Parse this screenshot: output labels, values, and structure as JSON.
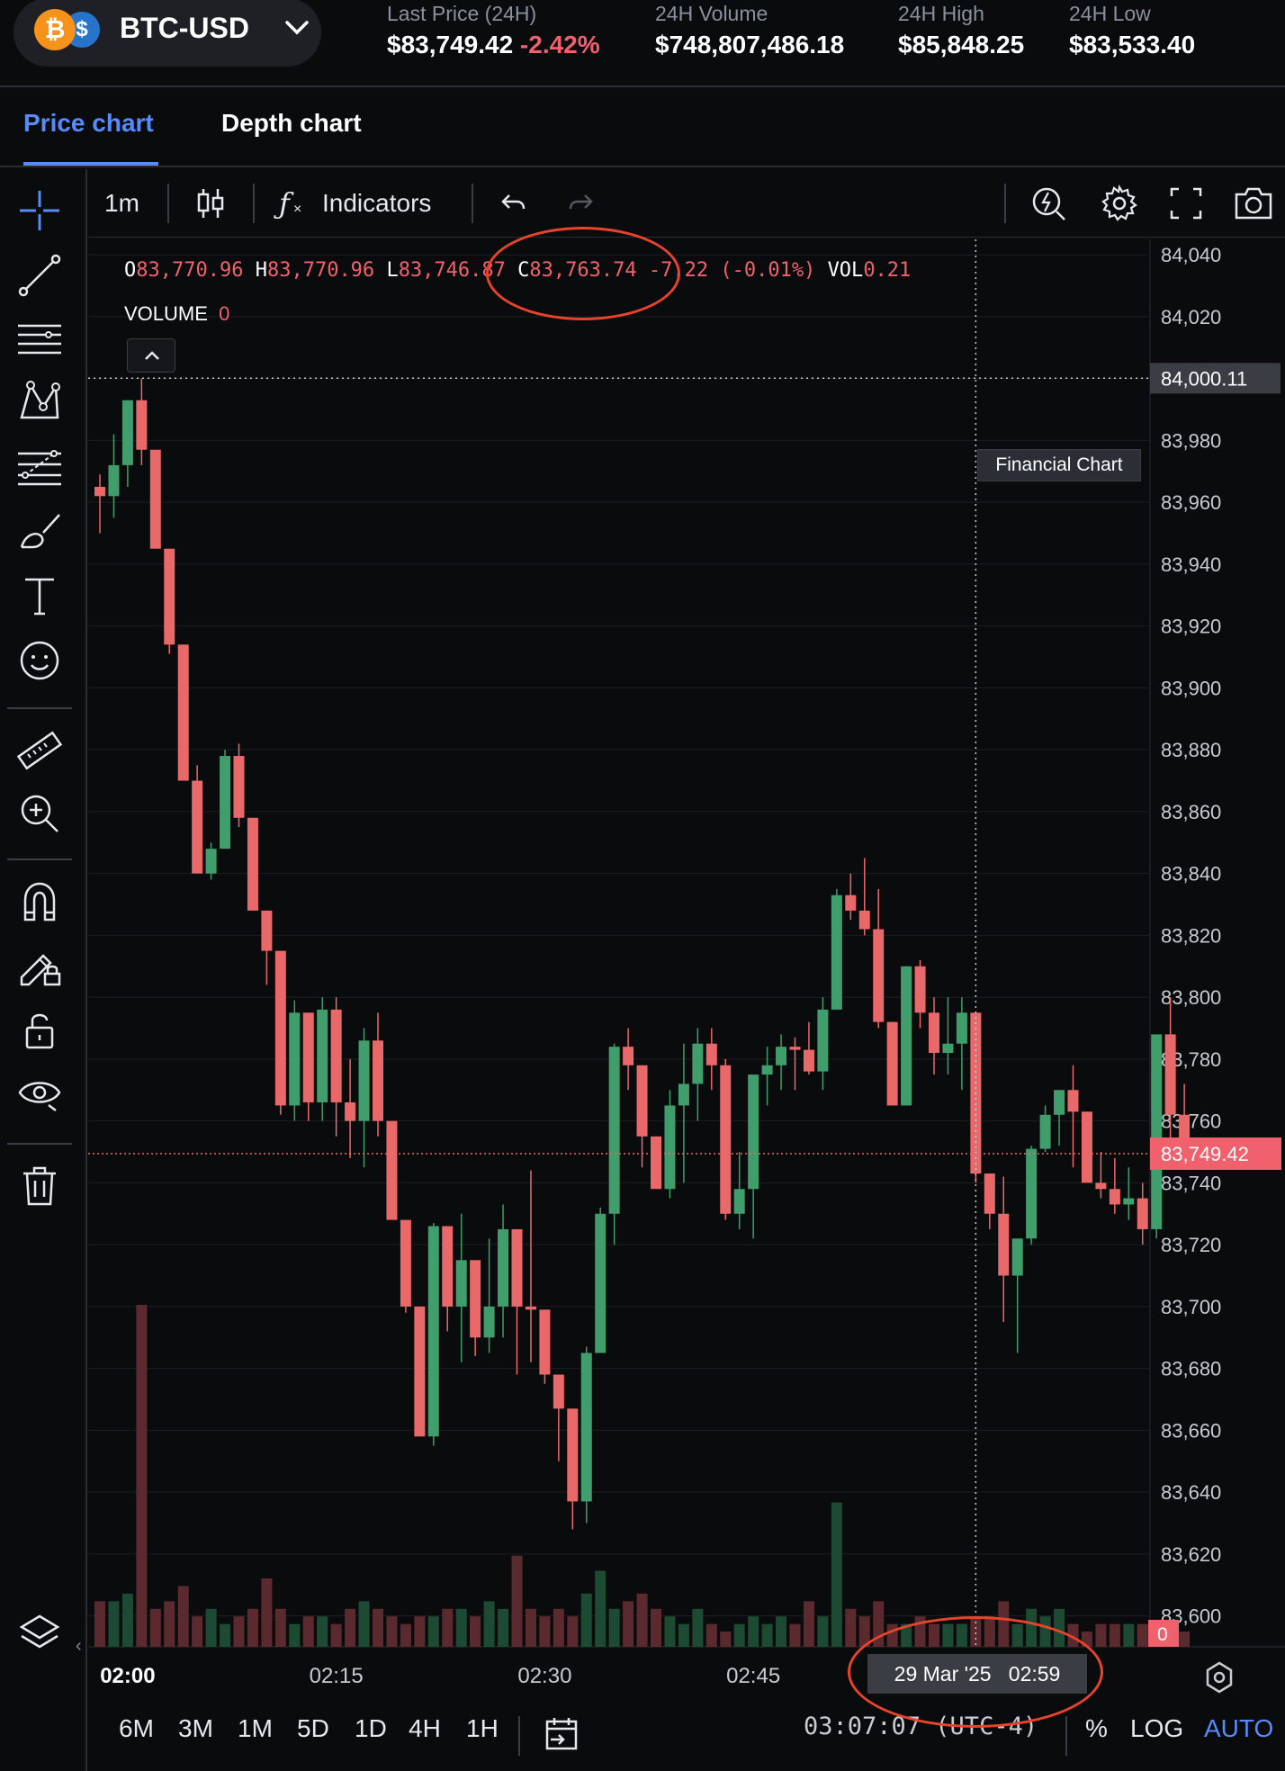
{
  "header": {
    "pair": "BTC-USD",
    "coin_btc": "₿",
    "coin_usd": "$",
    "stats": [
      {
        "label": "Last Price (24H)",
        "value": "$83,749.42",
        "change": "-2.42%"
      },
      {
        "label": "24H Volume",
        "value": "$748,807,486.18"
      },
      {
        "label": "24H High",
        "value": "$85,848.25"
      },
      {
        "label": "24H Low",
        "value": "$83,533.40"
      }
    ]
  },
  "tabs": [
    {
      "label": "Price chart",
      "active": true
    },
    {
      "label": "Depth chart",
      "active": false
    }
  ],
  "toolbar": {
    "interval": "1m",
    "fx": "ƒ",
    "indicators_label": "Indicators"
  },
  "sidebar_tools": [
    "crosshair-icon",
    "trend-line-icon",
    "horizontal-lines-icon",
    "pattern-icon",
    "fib-levels-icon",
    "brush-icon",
    "text-tool-icon",
    "emoji-icon",
    "ruler-icon",
    "zoom-in-icon",
    "magnet-icon",
    "lock-drawing-icon",
    "unlock-icon",
    "eye-icon",
    "trash-icon",
    "layers-icon"
  ],
  "legend": {
    "o_label": "O",
    "o": "83,770.96",
    "h_label": "H",
    "h": "83,770.96",
    "l_label": "L",
    "l": "83,746.87",
    "c_label": "C",
    "c": "83,763.74",
    "change": "-7.22 (-0.01%)",
    "vol_label": "VOL",
    "vol": "0.21",
    "volume_label": "VOLUME",
    "volume": "0"
  },
  "tooltip": "Financial Chart",
  "bottom": {
    "ranges": [
      "6M",
      "3M",
      "1M",
      "5D",
      "1D",
      "4H",
      "1H"
    ],
    "clock": "03:07:07 (UTC-4)",
    "options": [
      {
        "label": "%",
        "active": false
      },
      {
        "label": "LOG",
        "active": false
      },
      {
        "label": "AUTO",
        "active": true
      }
    ]
  },
  "chart_data": {
    "type": "candlestick",
    "interval": "1m",
    "ylim": [
      83590,
      84045
    ],
    "y_ticks": [
      "84,040",
      "84,020",
      "84,000",
      "83,980",
      "83,960",
      "83,940",
      "83,920",
      "83,900",
      "83,880",
      "83,860",
      "83,840",
      "83,820",
      "83,800",
      "83,780",
      "83,760",
      "83,740",
      "83,720",
      "83,700",
      "83,680",
      "83,660",
      "83,640",
      "83,620",
      "83,600"
    ],
    "x_ticks": [
      "02:00",
      "02:15",
      "02:30",
      "02:45"
    ],
    "x_tick_index": [
      2,
      17,
      32,
      47
    ],
    "crosshair_price": "84,000.11",
    "crosshair_y": 84000.11,
    "crosshair_index": 63,
    "crosshair_time": "29 Mar '25   02:59",
    "last_price": "83,749.42",
    "last_price_y": 83749.42,
    "volume_last": "0",
    "colors": {
      "up": "#3f9e6b",
      "down": "#e9686a",
      "up_vol": "#1d4a33",
      "down_vol": "#5a2a2e",
      "grid": "#1c1e22"
    },
    "candles": [
      [
        83965,
        83969,
        83950,
        83962
      ],
      [
        83962,
        83982,
        83955,
        83972
      ],
      [
        83972,
        83993,
        83965,
        83993
      ],
      [
        83993,
        84000,
        83972,
        83977
      ],
      [
        83977,
        83977,
        83947,
        83945
      ],
      [
        83945,
        83945,
        83911,
        83914
      ],
      [
        83914,
        83914,
        83870,
        83870
      ],
      [
        83870,
        83875,
        83843,
        83840
      ],
      [
        83840,
        83850,
        83838,
        83848
      ],
      [
        83848,
        83880,
        83848,
        83878
      ],
      [
        83878,
        83882,
        83855,
        83858
      ],
      [
        83858,
        83858,
        83832,
        83828
      ],
      [
        83828,
        83828,
        83804,
        83815
      ],
      [
        83815,
        83815,
        83762,
        83765
      ],
      [
        83765,
        83799,
        83760,
        83795
      ],
      [
        83795,
        83795,
        83760,
        83766
      ],
      [
        83766,
        83800,
        83760,
        83796
      ],
      [
        83796,
        83800,
        83755,
        83766
      ],
      [
        83766,
        83780,
        83748,
        83760
      ],
      [
        83760,
        83790,
        83745,
        83786
      ],
      [
        83786,
        83795,
        83755,
        83760
      ],
      [
        83760,
        83760,
        83734,
        83728
      ],
      [
        83728,
        83728,
        83698,
        83700
      ],
      [
        83700,
        83700,
        83660,
        83658
      ],
      [
        83658,
        83727,
        83655,
        83726
      ],
      [
        83726,
        83726,
        83692,
        83700
      ],
      [
        83700,
        83730,
        83682,
        83715
      ],
      [
        83715,
        83715,
        83684,
        83690
      ],
      [
        83690,
        83722,
        83685,
        83700
      ],
      [
        83700,
        83733,
        83690,
        83725
      ],
      [
        83725,
        83725,
        83678,
        83700
      ],
      [
        83700,
        83744,
        83682,
        83699
      ],
      [
        83699,
        83699,
        83675,
        83678
      ],
      [
        83678,
        83678,
        83650,
        83667
      ],
      [
        83667,
        83667,
        83628,
        83637
      ],
      [
        83637,
        83687,
        83630,
        83685
      ],
      [
        83685,
        83732,
        83685,
        83730
      ],
      [
        83730,
        83785,
        83720,
        83784
      ],
      [
        83784,
        83790,
        83770,
        83778
      ],
      [
        83778,
        83778,
        83745,
        83755
      ],
      [
        83755,
        83755,
        83740,
        83738
      ],
      [
        83738,
        83770,
        83735,
        83765
      ],
      [
        83765,
        83785,
        83740,
        83772
      ],
      [
        83772,
        83790,
        83760,
        83785
      ],
      [
        83785,
        83790,
        83770,
        83778
      ],
      [
        83778,
        83780,
        83728,
        83730
      ],
      [
        83730,
        83750,
        83725,
        83738
      ],
      [
        83738,
        83770,
        83722,
        83775
      ],
      [
        83775,
        83784,
        83765,
        83778
      ],
      [
        83778,
        83788,
        83770,
        83784
      ],
      [
        83784,
        83787,
        83770,
        83783
      ],
      [
        83783,
        83792,
        83775,
        83776
      ],
      [
        83776,
        83800,
        83770,
        83796
      ],
      [
        83796,
        83835,
        83796,
        83833
      ],
      [
        83833,
        83840,
        83825,
        83828
      ],
      [
        83828,
        83845,
        83820,
        83822
      ],
      [
        83822,
        83835,
        83790,
        83792
      ],
      [
        83792,
        83792,
        83765,
        83765
      ],
      [
        83765,
        83810,
        83765,
        83810
      ],
      [
        83810,
        83812,
        83790,
        83795
      ],
      [
        83795,
        83800,
        83775,
        83782
      ],
      [
        83782,
        83800,
        83775,
        83785
      ],
      [
        83785,
        83800,
        83770,
        83795
      ],
      [
        83795,
        83795,
        83740,
        83743
      ],
      [
        83743,
        83743,
        83725,
        83730
      ],
      [
        83730,
        83742,
        83695,
        83710
      ],
      [
        83710,
        83722,
        83685,
        83722
      ],
      [
        83722,
        83752,
        83720,
        83751
      ],
      [
        83751,
        83765,
        83750,
        83762
      ],
      [
        83762,
        83770,
        83752,
        83770
      ],
      [
        83770,
        83778,
        83745,
        83763
      ],
      [
        83763,
        83763,
        83744,
        83740
      ],
      [
        83740,
        83750,
        83735,
        83738
      ],
      [
        83738,
        83748,
        83730,
        83733
      ],
      [
        83733,
        83745,
        83728,
        83735
      ],
      [
        83735,
        83740,
        83720,
        83725
      ],
      [
        83725,
        83770,
        83722,
        83788
      ],
      [
        83788,
        83800,
        83752,
        83762
      ],
      [
        83762,
        83772,
        83748,
        83750
      ]
    ],
    "volumes": [
      6,
      6,
      7,
      45,
      5,
      6,
      8,
      4,
      5,
      3,
      4,
      5,
      9,
      5,
      3,
      4,
      4,
      3,
      5,
      6,
      5,
      4,
      3,
      4,
      4,
      5,
      5,
      4,
      6,
      5,
      12,
      5,
      4,
      5,
      4,
      7,
      10,
      5,
      6,
      7,
      5,
      4,
      3,
      5,
      3,
      2,
      3,
      4,
      3,
      4,
      3,
      6,
      4,
      19,
      5,
      4,
      6,
      3,
      3,
      4,
      3,
      3,
      3,
      4,
      4,
      6,
      3,
      5,
      4,
      5,
      3,
      2,
      3,
      3,
      3,
      3,
      3,
      3,
      2
    ]
  }
}
